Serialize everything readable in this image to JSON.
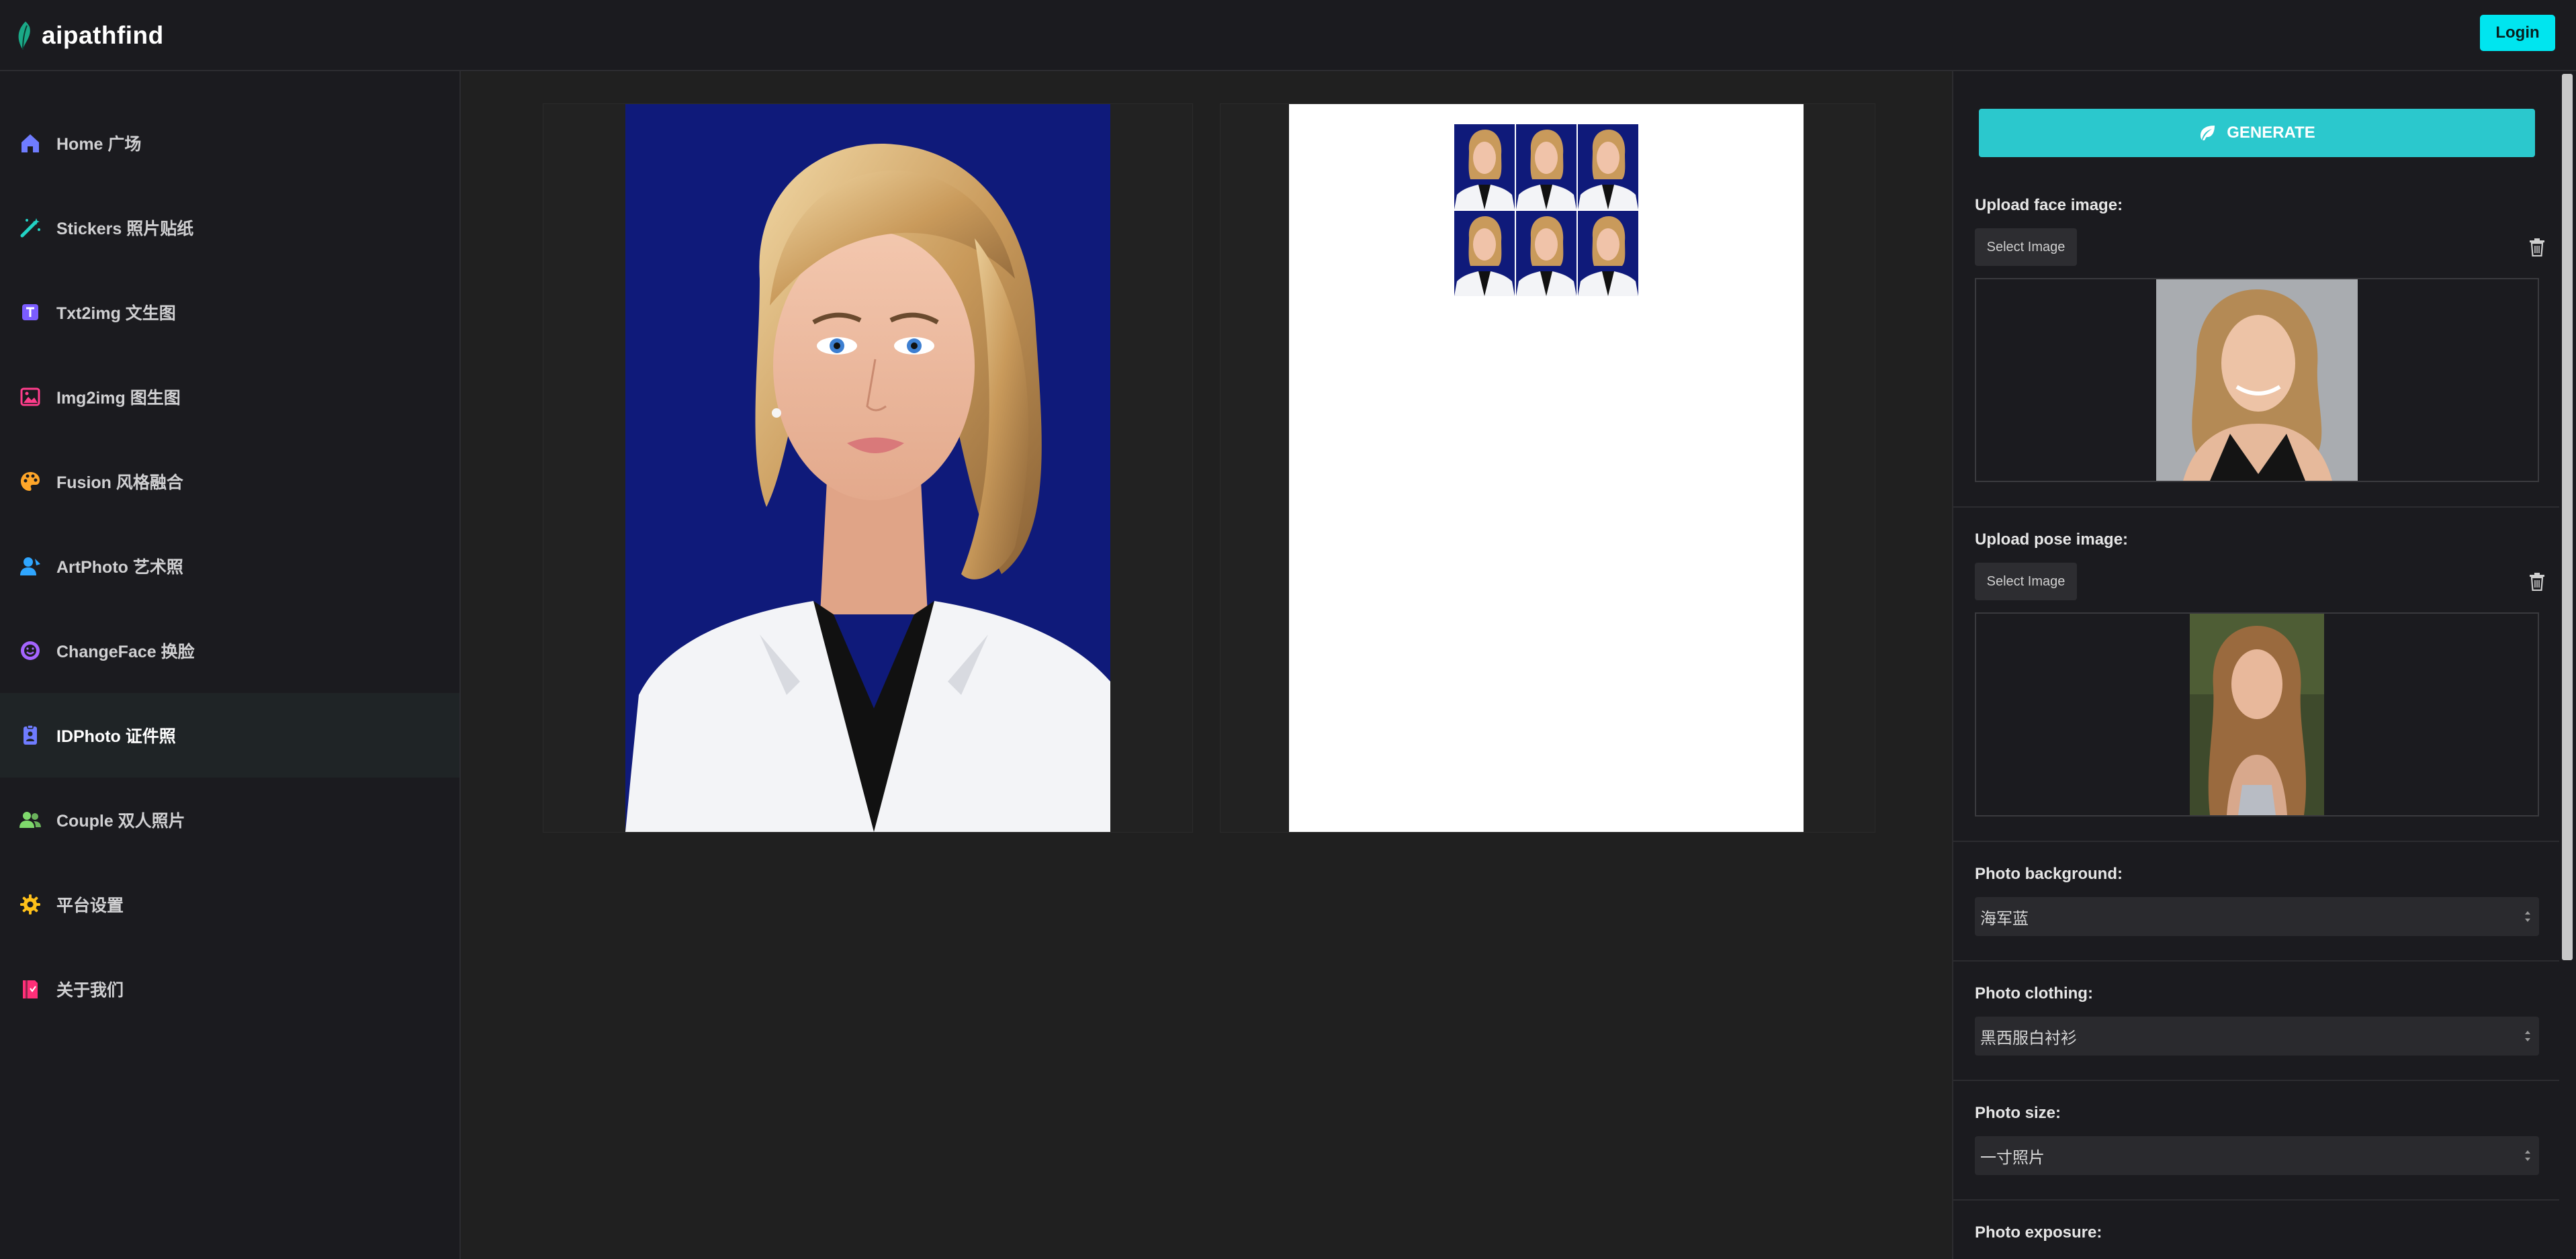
{
  "header": {
    "logo_text": "aipathfind",
    "login_label": "Login"
  },
  "sidebar": {
    "items": [
      {
        "label": "Home 广场",
        "icon": "home-icon",
        "color": "#6f7cff"
      },
      {
        "label": "Stickers 照片贴纸",
        "icon": "magic-wand-icon",
        "color": "#22d3c5"
      },
      {
        "label": "Txt2img 文生图",
        "icon": "text-t-icon",
        "color": "#7b5cff"
      },
      {
        "label": "Img2img 图生图",
        "icon": "image-icon",
        "color": "#ff3d8b"
      },
      {
        "label": "Fusion 风格融合",
        "icon": "palette-icon",
        "color": "#ffa629"
      },
      {
        "label": "ArtPhoto 艺术照",
        "icon": "user-art-icon",
        "color": "#2fa6ff"
      },
      {
        "label": "ChangeFace 换脸",
        "icon": "face-icon",
        "color": "#a565ff"
      },
      {
        "label": "IDPhoto 证件照",
        "icon": "id-badge-icon",
        "color": "#6f7cff",
        "active": true
      },
      {
        "label": "Couple 双人照片",
        "icon": "users-icon",
        "color": "#7fd96c"
      },
      {
        "label": "平台设置",
        "icon": "gear-icon",
        "color": "#ffc11a"
      },
      {
        "label": "关于我们",
        "icon": "book-icon",
        "color": "#ff2f78"
      }
    ]
  },
  "panel": {
    "generate_label": "GENERATE",
    "face_label": "Upload face image:",
    "pose_label": "Upload pose image:",
    "select_image_label": "Select Image",
    "background_label": "Photo background:",
    "background_value": "海军蓝",
    "clothing_label": "Photo clothing:",
    "clothing_value": "黑西服白衬衫",
    "size_label": "Photo size:",
    "size_value": "一寸照片",
    "exposure_label": "Photo exposure:"
  },
  "colors": {
    "accent": "#00e5ef",
    "generate": "#2bc8cd",
    "navy_background": "#0f1a7a"
  }
}
